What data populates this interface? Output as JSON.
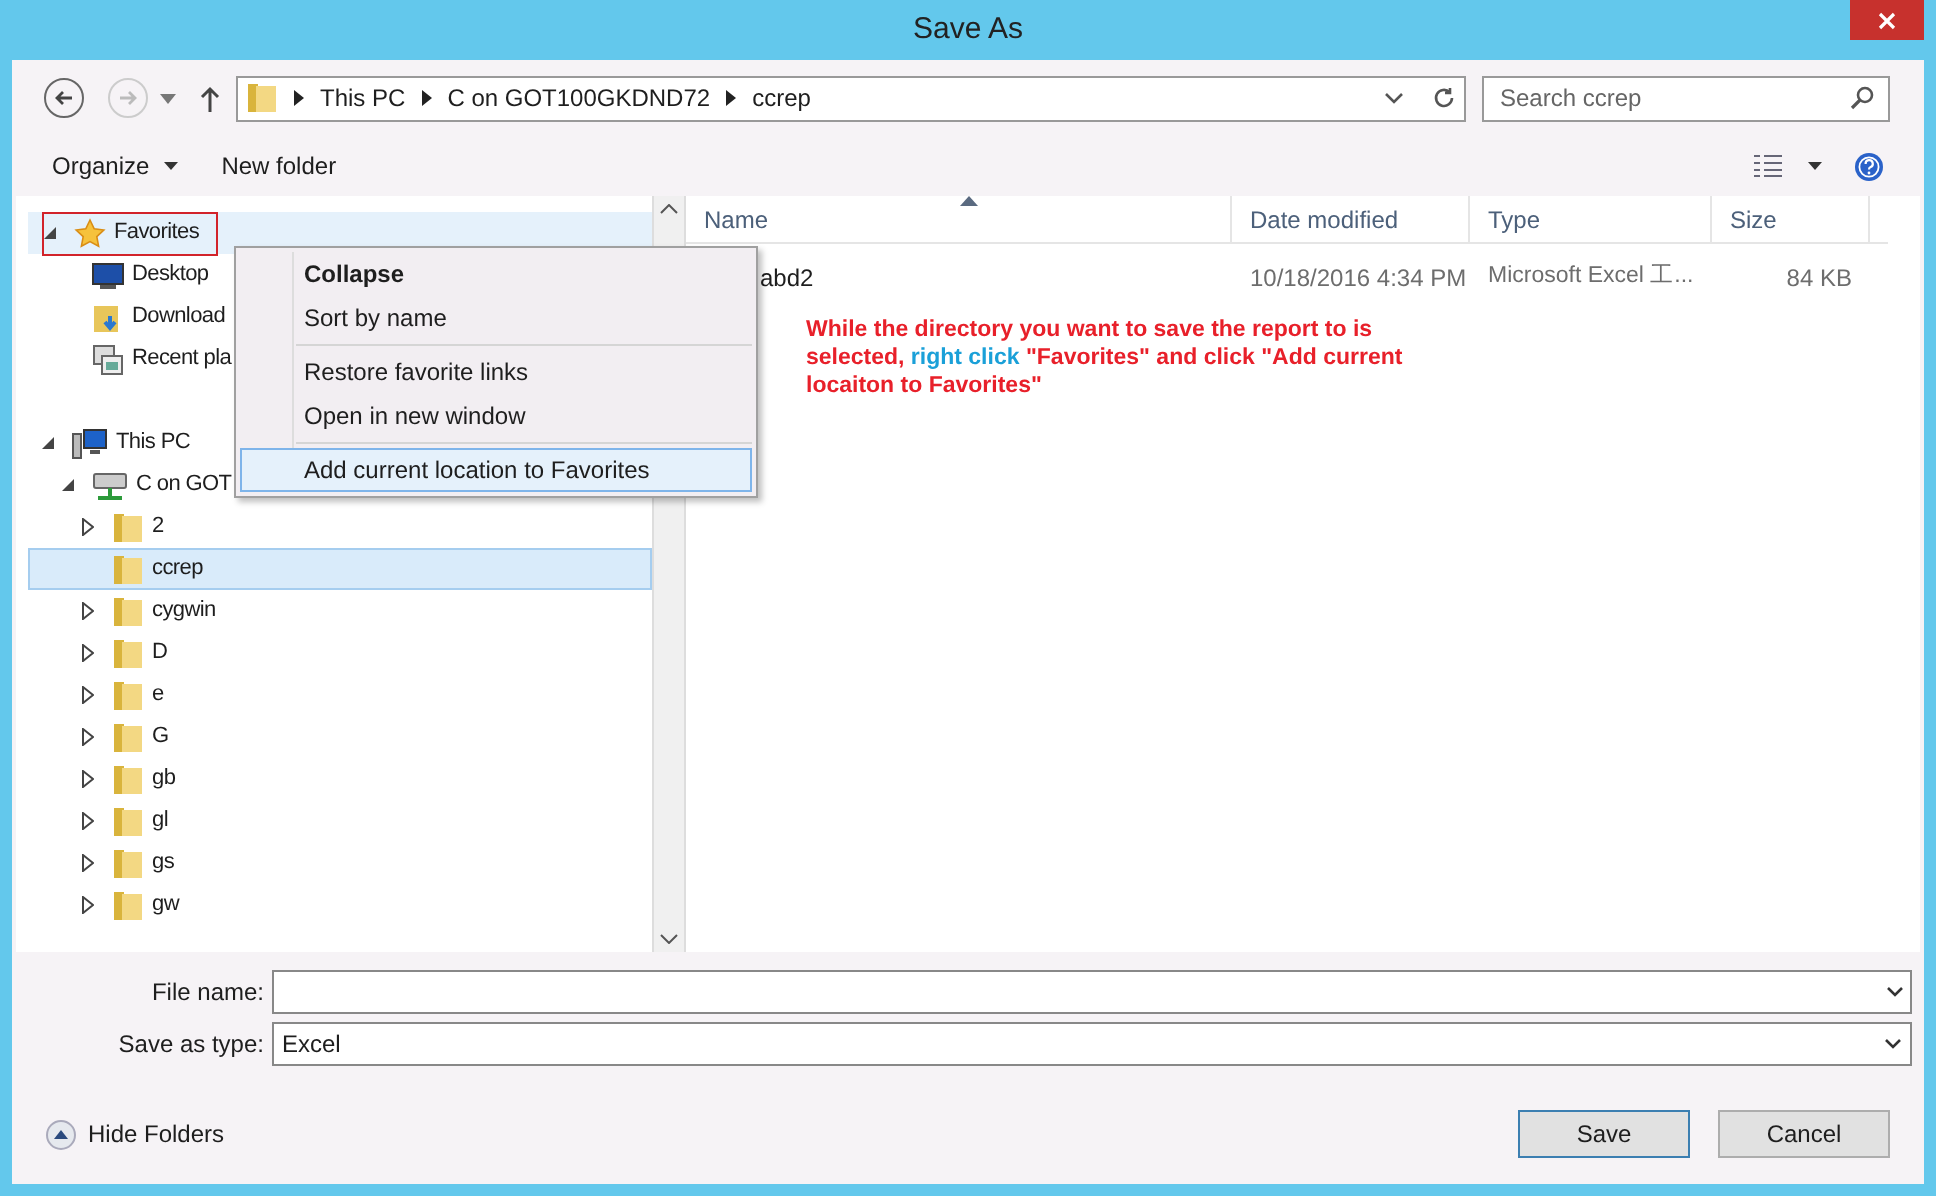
{
  "window": {
    "title": "Save As"
  },
  "address_bar": {
    "crumbs": [
      "This PC",
      "C on GOT100GKDND72",
      "ccrep"
    ]
  },
  "search": {
    "placeholder": "Search ccrep"
  },
  "toolbar": {
    "organize": "Organize",
    "new_folder": "New folder"
  },
  "tree": [
    {
      "label": "Favorites",
      "expanded": true,
      "selected": false,
      "highlighted": true,
      "kind": "star",
      "children": [
        {
          "label": "Desktop",
          "kind": "desktop",
          "selected": false
        },
        {
          "label": "Download",
          "kind": "downloads",
          "selected": false
        },
        {
          "label": "Recent pla",
          "kind": "recent",
          "selected": false
        }
      ]
    },
    {
      "label": "This PC",
      "expanded": true,
      "selected": false,
      "highlighted": false,
      "kind": "pc",
      "children": [
        {
          "label": "C on GOT",
          "expanded": true,
          "selected": false,
          "kind": "drive",
          "children": [
            {
              "label": "2",
              "expanded": false,
              "selected": false,
              "kind": "folder"
            },
            {
              "label": "ccrep",
              "selected": true,
              "kind": "folder"
            },
            {
              "label": "cygwin",
              "expanded": false,
              "selected": false,
              "kind": "folder"
            },
            {
              "label": "D",
              "expanded": false,
              "selected": false,
              "kind": "folder"
            },
            {
              "label": "e",
              "expanded": false,
              "selected": false,
              "kind": "folder"
            },
            {
              "label": "G",
              "expanded": false,
              "selected": false,
              "kind": "folder"
            },
            {
              "label": "gb",
              "expanded": false,
              "selected": false,
              "kind": "folder"
            },
            {
              "label": "gl",
              "expanded": false,
              "selected": false,
              "kind": "folder"
            },
            {
              "label": "gs",
              "expanded": false,
              "selected": false,
              "kind": "folder"
            },
            {
              "label": "gw",
              "expanded": false,
              "selected": false,
              "kind": "folder"
            }
          ]
        }
      ]
    }
  ],
  "context_menu": [
    {
      "label": "Collapse",
      "bold": true,
      "selected": false
    },
    {
      "label": "Sort by name",
      "bold": false,
      "selected": false,
      "separator_after": true
    },
    {
      "label": "Restore favorite links",
      "bold": false,
      "selected": false
    },
    {
      "label": "Open in new window",
      "bold": false,
      "selected": false,
      "separator_after": true
    },
    {
      "label": "Add current location to Favorites",
      "bold": false,
      "selected": true
    }
  ],
  "table": {
    "columns": [
      "Name",
      "Date modified",
      "Type",
      "Size"
    ],
    "rows": [
      {
        "name": "abd2",
        "date": "10/18/2016 4:34 PM",
        "type": "Microsoft Excel 工...",
        "size": "84 KB"
      }
    ]
  },
  "annotation": [
    {
      "text": "While the directory you want to save the report to is selected, ",
      "color": "#e8202a"
    },
    {
      "text": "right click",
      "color": "#1aa0d8"
    },
    {
      "text": " \"Favorites\" and click \"Add current locaiton to Favorites\"",
      "color": "#e8202a"
    }
  ],
  "file_name": {
    "label": "File name:"
  },
  "save_type": {
    "label": "Save as type:",
    "value": "Excel"
  },
  "hide_folders": "Hide Folders",
  "buttons": [
    "Save",
    "Cancel"
  ]
}
